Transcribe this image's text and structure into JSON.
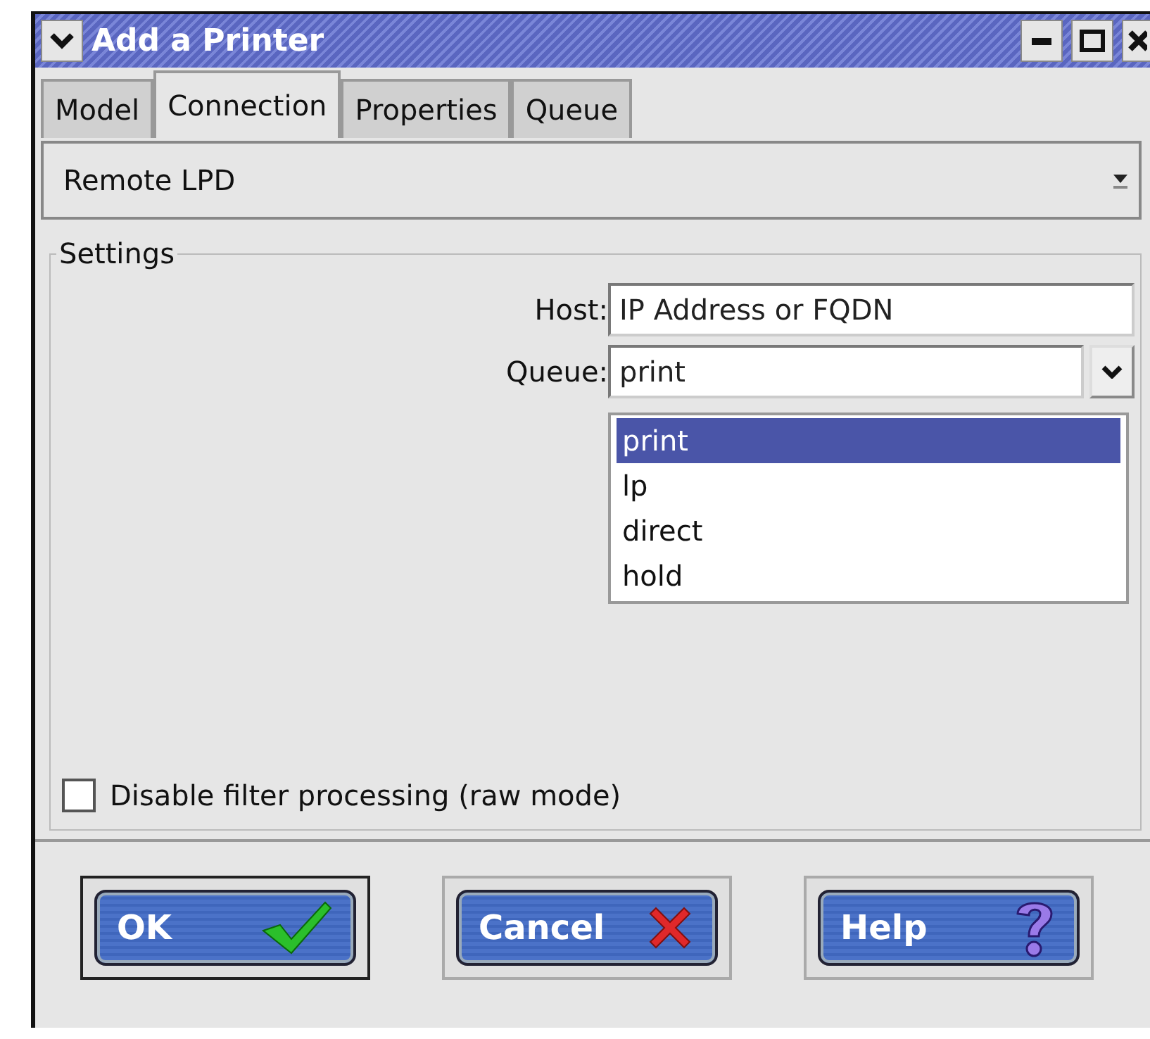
{
  "window": {
    "title": "Add a Printer"
  },
  "tabs": [
    {
      "label": "Model",
      "selected": false
    },
    {
      "label": "Connection",
      "selected": true
    },
    {
      "label": "Properties",
      "selected": false
    },
    {
      "label": "Queue",
      "selected": false
    }
  ],
  "connection_type": {
    "value": "Remote LPD"
  },
  "settings": {
    "title": "Settings",
    "host": {
      "label": "Host:",
      "value": "IP Address or FQDN"
    },
    "queue": {
      "label": "Queue:",
      "value": "print",
      "expanded": true,
      "options": [
        {
          "label": "print",
          "selected": true
        },
        {
          "label": "lp",
          "selected": false
        },
        {
          "label": "direct",
          "selected": false
        },
        {
          "label": "hold",
          "selected": false
        }
      ]
    },
    "raw_mode": {
      "label": "Disable filter processing (raw mode)",
      "checked": false
    }
  },
  "buttons": [
    {
      "label": "OK",
      "kind": "ok",
      "default": true
    },
    {
      "label": "Cancel",
      "kind": "cancel",
      "default": false
    },
    {
      "label": "Help",
      "kind": "help",
      "default": false
    }
  ]
}
